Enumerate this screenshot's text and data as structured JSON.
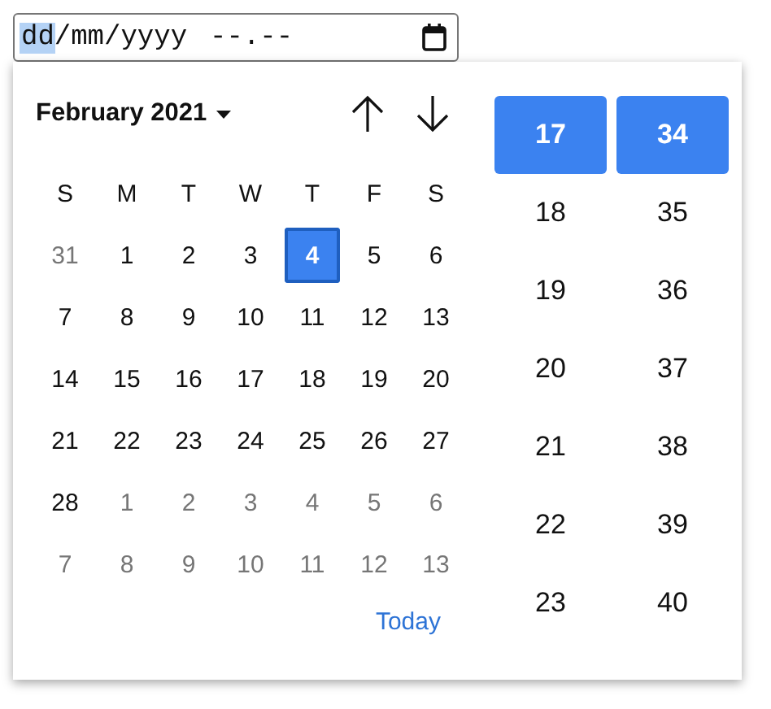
{
  "date_field": {
    "segments": [
      {
        "text": "dd",
        "kind": "part",
        "selected": true
      },
      {
        "text": "/",
        "kind": "sep",
        "selected": false
      },
      {
        "text": "mm",
        "kind": "part",
        "selected": false
      },
      {
        "text": "/",
        "kind": "sep",
        "selected": false
      },
      {
        "text": "yyyy",
        "kind": "part",
        "selected": false
      },
      {
        "text": "--",
        "kind": "part",
        "selected": false
      },
      {
        "text": ".",
        "kind": "sep",
        "selected": false
      },
      {
        "text": "--",
        "kind": "part",
        "selected": false
      }
    ]
  },
  "calendar": {
    "month_label": "February 2021",
    "weekdays": [
      "S",
      "M",
      "T",
      "W",
      "T",
      "F",
      "S"
    ],
    "days": [
      {
        "label": "31",
        "in_month": false,
        "selected": false
      },
      {
        "label": "1",
        "in_month": true,
        "selected": false
      },
      {
        "label": "2",
        "in_month": true,
        "selected": false
      },
      {
        "label": "3",
        "in_month": true,
        "selected": false
      },
      {
        "label": "4",
        "in_month": true,
        "selected": true
      },
      {
        "label": "5",
        "in_month": true,
        "selected": false
      },
      {
        "label": "6",
        "in_month": true,
        "selected": false
      },
      {
        "label": "7",
        "in_month": true,
        "selected": false
      },
      {
        "label": "8",
        "in_month": true,
        "selected": false
      },
      {
        "label": "9",
        "in_month": true,
        "selected": false
      },
      {
        "label": "10",
        "in_month": true,
        "selected": false
      },
      {
        "label": "11",
        "in_month": true,
        "selected": false
      },
      {
        "label": "12",
        "in_month": true,
        "selected": false
      },
      {
        "label": "13",
        "in_month": true,
        "selected": false
      },
      {
        "label": "14",
        "in_month": true,
        "selected": false
      },
      {
        "label": "15",
        "in_month": true,
        "selected": false
      },
      {
        "label": "16",
        "in_month": true,
        "selected": false
      },
      {
        "label": "17",
        "in_month": true,
        "selected": false
      },
      {
        "label": "18",
        "in_month": true,
        "selected": false
      },
      {
        "label": "19",
        "in_month": true,
        "selected": false
      },
      {
        "label": "20",
        "in_month": true,
        "selected": false
      },
      {
        "label": "21",
        "in_month": true,
        "selected": false
      },
      {
        "label": "22",
        "in_month": true,
        "selected": false
      },
      {
        "label": "23",
        "in_month": true,
        "selected": false
      },
      {
        "label": "24",
        "in_month": true,
        "selected": false
      },
      {
        "label": "25",
        "in_month": true,
        "selected": false
      },
      {
        "label": "26",
        "in_month": true,
        "selected": false
      },
      {
        "label": "27",
        "in_month": true,
        "selected": false
      },
      {
        "label": "28",
        "in_month": true,
        "selected": false
      },
      {
        "label": "1",
        "in_month": false,
        "selected": false
      },
      {
        "label": "2",
        "in_month": false,
        "selected": false
      },
      {
        "label": "3",
        "in_month": false,
        "selected": false
      },
      {
        "label": "4",
        "in_month": false,
        "selected": false
      },
      {
        "label": "5",
        "in_month": false,
        "selected": false
      },
      {
        "label": "6",
        "in_month": false,
        "selected": false
      },
      {
        "label": "7",
        "in_month": false,
        "selected": false
      },
      {
        "label": "8",
        "in_month": false,
        "selected": false
      },
      {
        "label": "9",
        "in_month": false,
        "selected": false
      },
      {
        "label": "10",
        "in_month": false,
        "selected": false
      },
      {
        "label": "11",
        "in_month": false,
        "selected": false
      },
      {
        "label": "12",
        "in_month": false,
        "selected": false
      },
      {
        "label": "13",
        "in_month": false,
        "selected": false
      }
    ],
    "today_button": "Today"
  },
  "time": {
    "hours": [
      {
        "label": "17",
        "selected": true
      },
      {
        "label": "18",
        "selected": false
      },
      {
        "label": "19",
        "selected": false
      },
      {
        "label": "20",
        "selected": false
      },
      {
        "label": "21",
        "selected": false
      },
      {
        "label": "22",
        "selected": false
      },
      {
        "label": "23",
        "selected": false
      }
    ],
    "minutes": [
      {
        "label": "34",
        "selected": true
      },
      {
        "label": "35",
        "selected": false
      },
      {
        "label": "36",
        "selected": false
      },
      {
        "label": "37",
        "selected": false
      },
      {
        "label": "38",
        "selected": false
      },
      {
        "label": "39",
        "selected": false
      },
      {
        "label": "40",
        "selected": false
      }
    ]
  }
}
